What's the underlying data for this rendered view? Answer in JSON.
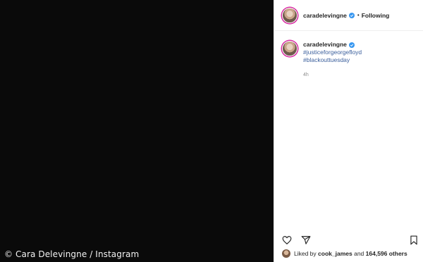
{
  "image": {
    "credit": "© Cara Delevingne / Instagram",
    "background": "#0a0a0a"
  },
  "header": {
    "username": "caradelevingne",
    "separator": "•",
    "follow_status": "Following"
  },
  "caption": {
    "username": "caradelevingne",
    "hashtags": [
      "#justiceforgeorgefloyd",
      "#blackouttuesday"
    ],
    "timestamp": "4h"
  },
  "actions": {
    "icons": [
      "heart-icon",
      "share-icon",
      "bookmark-icon"
    ]
  },
  "likes": {
    "prefix": "Liked by",
    "user": "cook_james",
    "middle": "and",
    "count": "164,596 others"
  },
  "colors": {
    "verified": "#3897f0",
    "hashtag": "#3b5f9c",
    "muted": "#8e8e8e"
  }
}
